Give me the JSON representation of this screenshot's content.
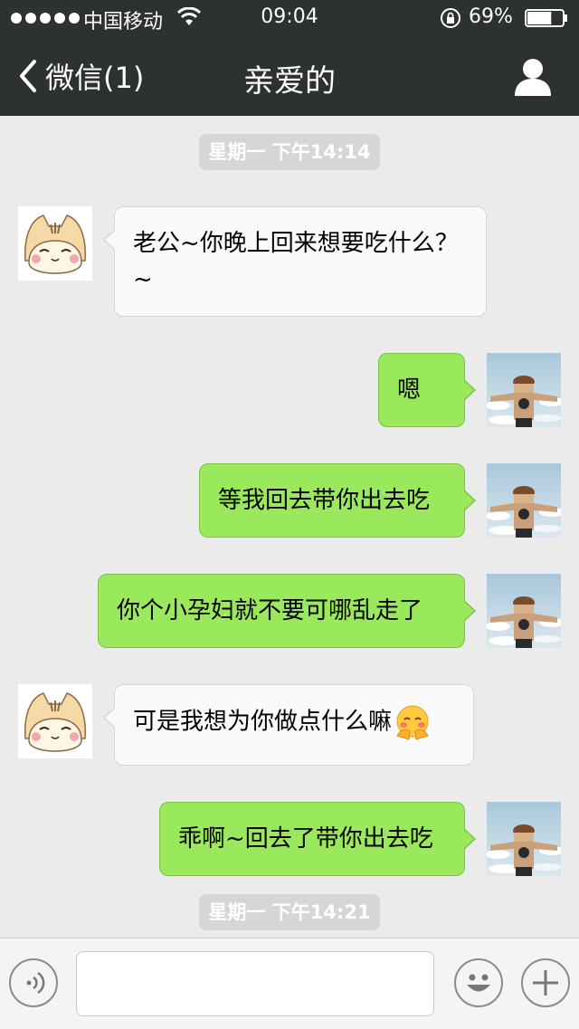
{
  "status_bar": {
    "carrier": "中国移动",
    "time": "09:04",
    "battery": "69%",
    "battery_level": 0.69
  },
  "nav": {
    "back_label": "微信(1)",
    "title": "亲爱的",
    "icons": {
      "back": "chevron-left-icon",
      "profile": "person-icon"
    }
  },
  "timestamps": [
    "星期一 下午14:14",
    "星期一 下午14:21"
  ],
  "messages": [
    {
      "side": "incoming",
      "text": "老公~你晚上回来想要吃什么？~",
      "avatar": "cat-avatar"
    },
    {
      "side": "outgoing",
      "text": "嗯",
      "avatar": "anime-avatar"
    },
    {
      "side": "outgoing",
      "text": "等我回去带你出去吃",
      "avatar": "anime-avatar"
    },
    {
      "side": "outgoing",
      "text": "你个小孕妇就不要可哪乱走了",
      "avatar": "anime-avatar"
    },
    {
      "side": "incoming",
      "text": "可是我想为你做点什么嘛",
      "emoji": "blushing-hands-emoji",
      "avatar": "cat-avatar"
    },
    {
      "side": "outgoing",
      "text": "乖啊~回去了带你出去吃",
      "avatar": "anime-avatar"
    }
  ],
  "input": {
    "value": "",
    "icons": {
      "voice": "voice-icon",
      "emoji": "smiley-icon",
      "plus": "plus-icon"
    }
  },
  "colors": {
    "header": "#2e3132",
    "background": "#ebebeb",
    "bubble_out": "#9ae85b",
    "bubble_in": "#fafafa"
  }
}
